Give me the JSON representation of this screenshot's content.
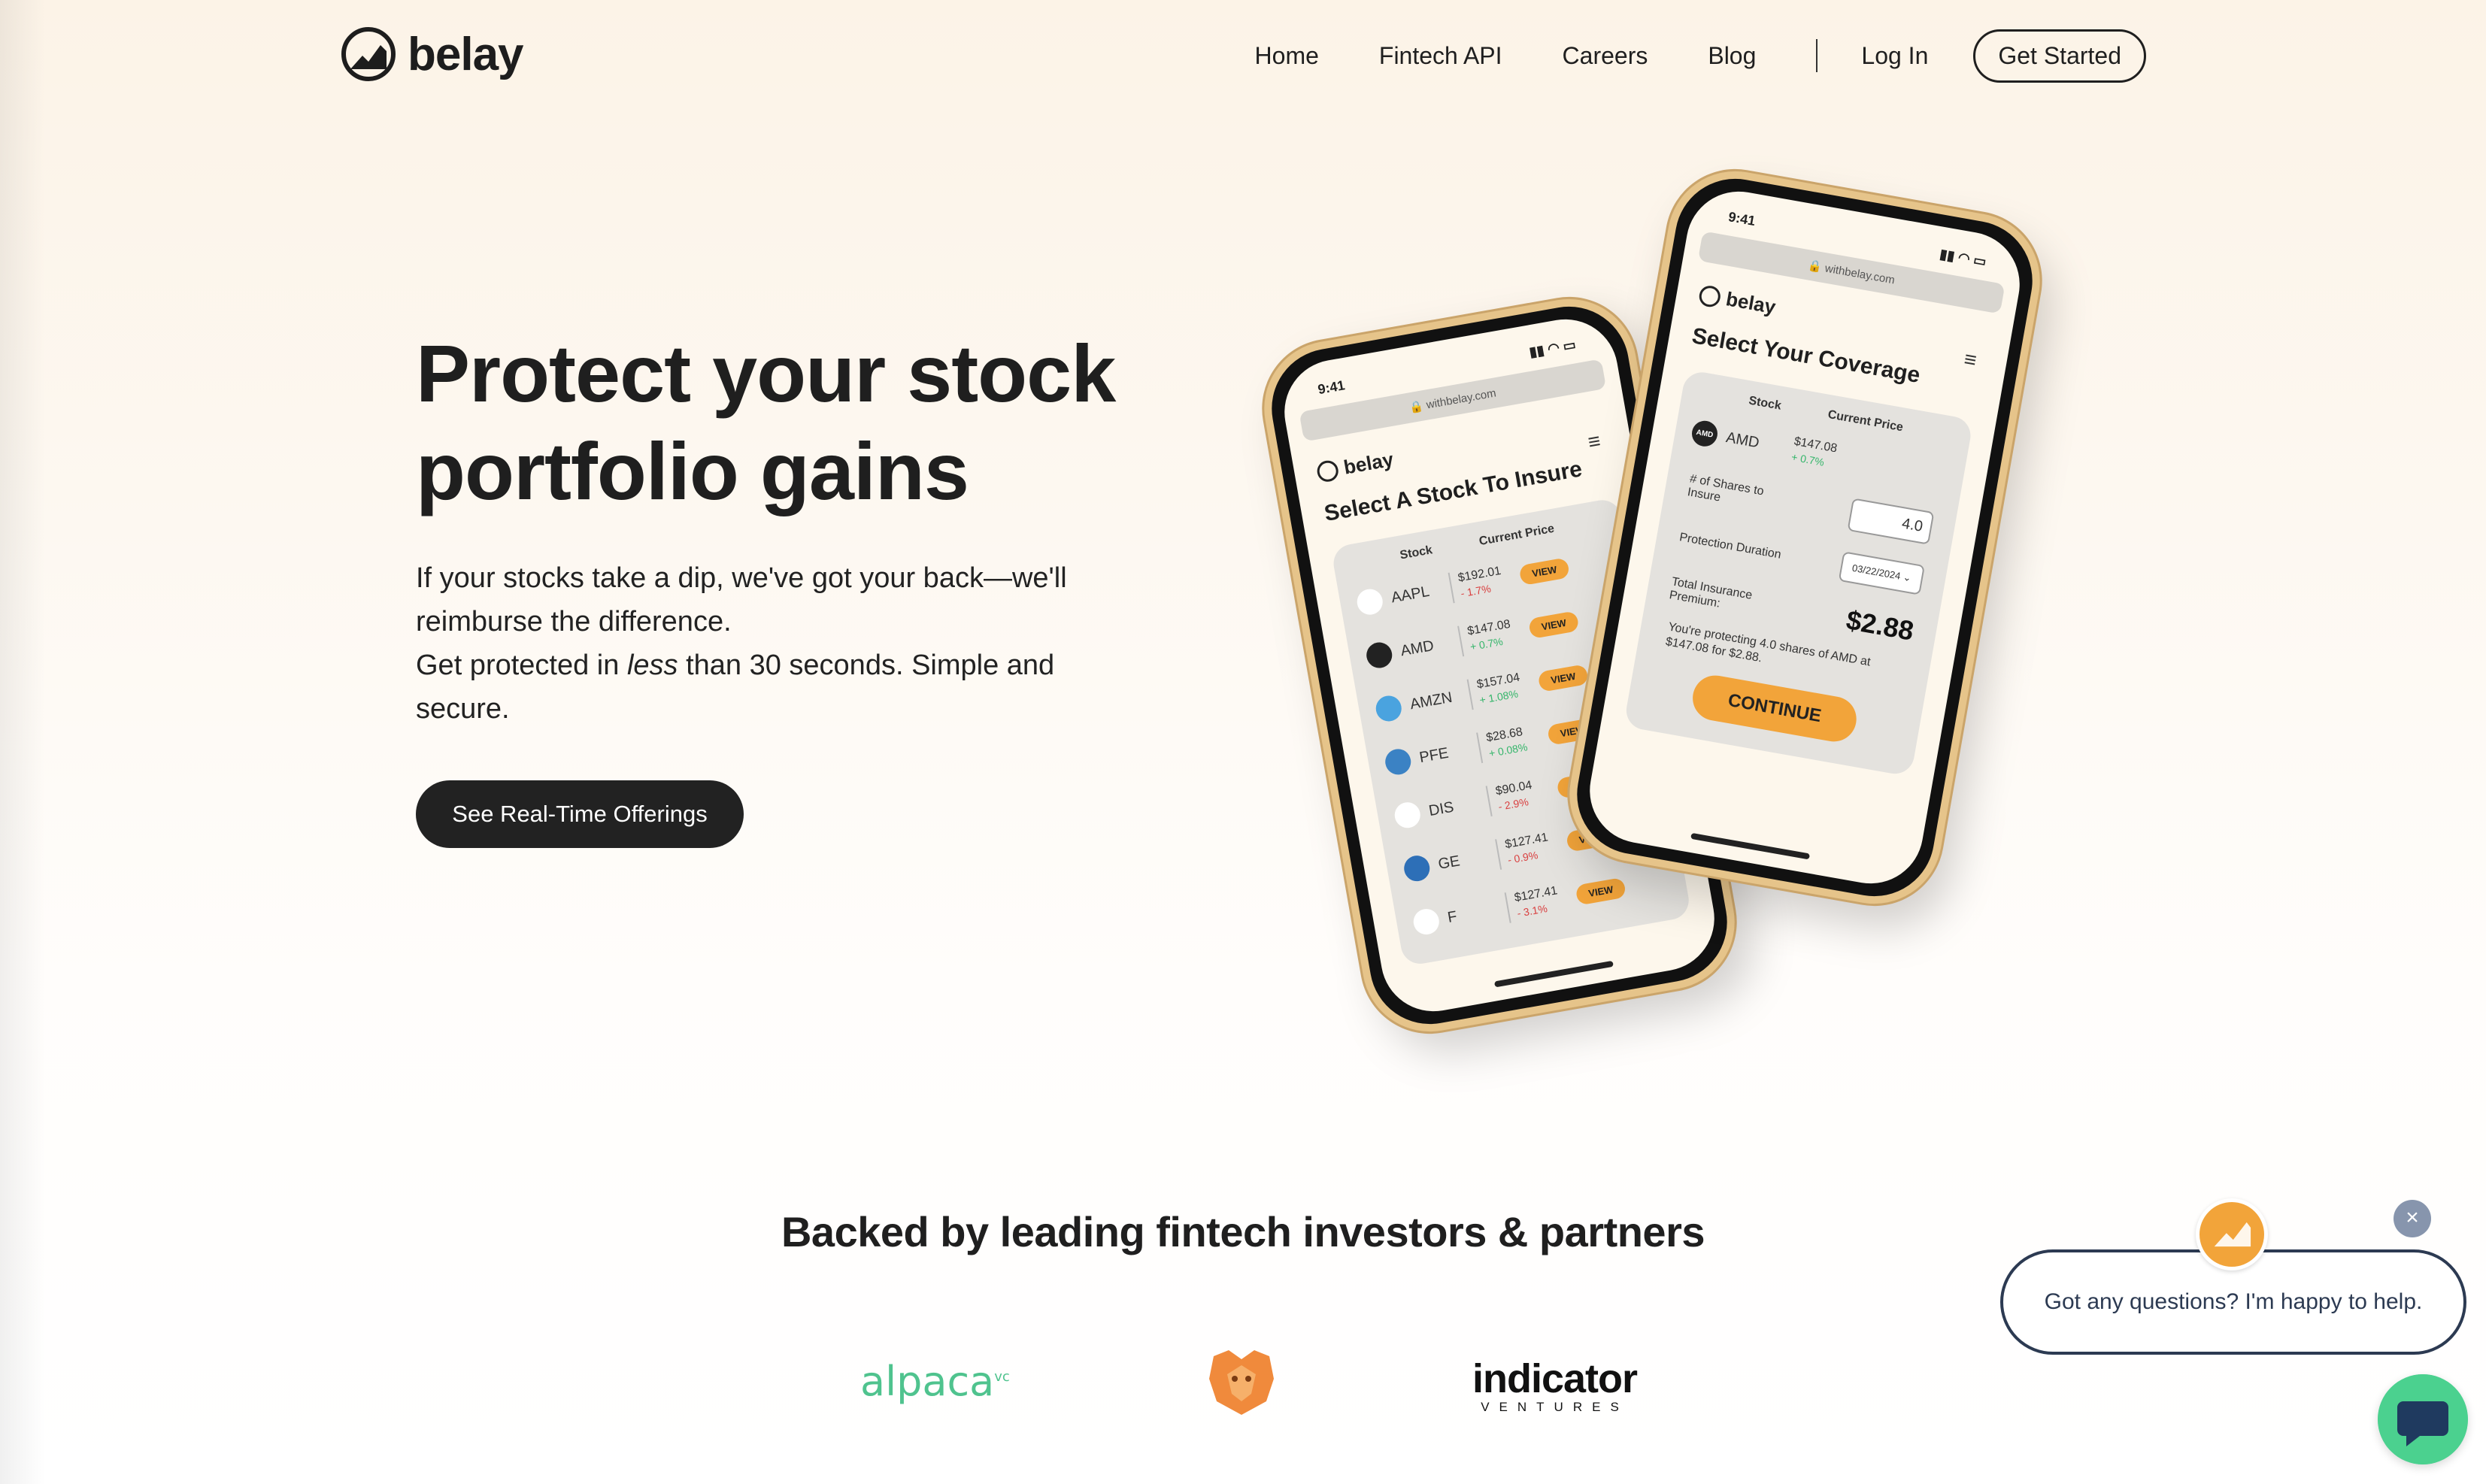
{
  "brand": {
    "name": "belay"
  },
  "nav": {
    "items": [
      "Home",
      "Fintech API",
      "Careers",
      "Blog"
    ],
    "login": "Log In",
    "get_started": "Get Started"
  },
  "hero": {
    "title": "Protect your stock portfolio gains",
    "sub_line1": "If your stocks take a dip, we've got your back—we'll reimburse the difference.",
    "sub_line2_a": "Get protected in ",
    "sub_line2_em": "less",
    "sub_line2_b": " than 30 seconds. Simple and secure.",
    "cta": "See Real-Time Offerings"
  },
  "phone_left": {
    "time": "9:41",
    "url": "withbelay.com",
    "brand": "belay",
    "title": "Select A Stock To Insure",
    "col_stock": "Stock",
    "col_price": "Current Price",
    "view_label": "VIEW",
    "stocks": [
      {
        "sym": "AAPL",
        "price": "$192.01",
        "chg": "- 1.7%",
        "dir": "down"
      },
      {
        "sym": "AMD",
        "price": "$147.08",
        "chg": "+ 0.7%",
        "dir": "up"
      },
      {
        "sym": "AMZN",
        "price": "$157.04",
        "chg": "+ 1.08%",
        "dir": "up"
      },
      {
        "sym": "PFE",
        "price": "$28.68",
        "chg": "+ 0.08%",
        "dir": "up"
      },
      {
        "sym": "DIS",
        "price": "$90.04",
        "chg": "- 2.9%",
        "dir": "down"
      },
      {
        "sym": "GE",
        "price": "$127.41",
        "chg": "- 0.9%",
        "dir": "down"
      },
      {
        "sym": "F",
        "price": "$127.41",
        "chg": "- 3.1%",
        "dir": "down"
      }
    ]
  },
  "phone_right": {
    "time": "9:41",
    "url": "withbelay.com",
    "brand": "belay",
    "title": "Select Your Coverage",
    "col_stock": "Stock",
    "col_price": "Current Price",
    "stock_sym": "AMD",
    "stock_price": "$147.08",
    "stock_chg": "+ 0.7%",
    "shares_label": "# of Shares to Insure",
    "shares_value": "4.0",
    "duration_label": "Protection Duration",
    "duration_value": "03/22/2024",
    "premium_label": "Total Insurance Premium:",
    "premium_value": "$2.88",
    "note": "You're protecting 4.0 shares of AMD at $147.08 for $2.88.",
    "continue": "CONTINUE"
  },
  "backed": {
    "title": "Backed by leading fintech investors & partners",
    "alpaca": "alpaca",
    "alpaca_sup": "vc",
    "indicator_big": "indicator",
    "indicator_small": "VENTURES"
  },
  "chat": {
    "message": "Got any questions? I'm happy to help.",
    "close": "×"
  },
  "colors": {
    "accent": "#f2a43a",
    "dark": "#222222",
    "chat_green": "#4bd18f",
    "chat_navy": "#2c3a52"
  }
}
